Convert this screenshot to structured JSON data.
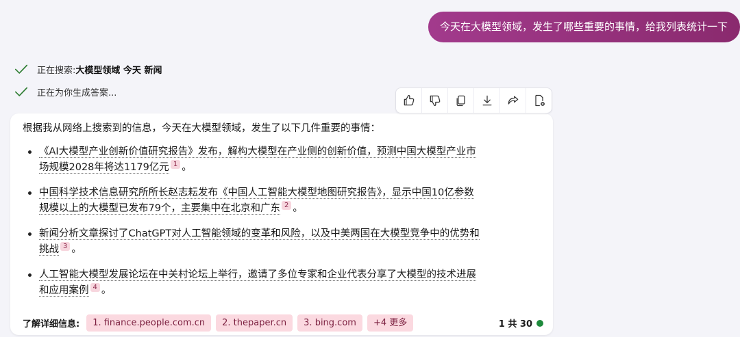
{
  "user_message": "今天在大模型领域，发生了哪些重要的事情，给我列表统计一下",
  "status": {
    "search_prefix": "正在搜索: ",
    "search_query": "大模型领域 今天 新闻",
    "generating": "正在为你生成答案..."
  },
  "toolbar": {
    "icons": [
      "thumbs-up-icon",
      "thumbs-down-icon",
      "copy-icon",
      "download-icon",
      "share-icon",
      "export-icon"
    ]
  },
  "answer": {
    "intro": "根据我从网络上搜索到的信息，今天在大模型领域，发生了以下几件重要的事情：",
    "items": [
      {
        "line1": "《AI大模型产业创新价值研究报告》发布，解构大模型在产业侧的创新价值，预测中国大模型产业市",
        "line2": "场规模2028年将达1179亿元",
        "cite": "1",
        "end": "。"
      },
      {
        "line1": "中国科学技术信息研究所所长赵志耘发布《中国人工智能大模型地图研究报告》，显示中国10亿参数",
        "line2": "规模以上的大模型已发布79个，主要集中在北京和广东",
        "cite": "2",
        "end": "。"
      },
      {
        "line1": "新闻分析文章探讨了ChatGPT对人工智能领域的变革和风险，以及中美两国在大模型竞争中的优势和",
        "line2": "挑战",
        "cite": "3",
        "end": "。"
      },
      {
        "line1": "人工智能大模型发展论坛在中关村论坛上举行，邀请了多位专家和企业代表分享了大模型的技术进展",
        "line2": "和应用案例",
        "cite": "4",
        "end": "。"
      }
    ]
  },
  "sources": {
    "label": "了解详细信息:",
    "links": [
      "1. finance.people.com.cn",
      "2. thepaper.cn",
      "3. bing.com"
    ],
    "more": "+4 更多",
    "counter": "1 共 30"
  },
  "colors": {
    "user_bubble": "#9b348a",
    "citation_chip": "#fbd9e0",
    "status_check": "#2e7d32",
    "counter_dot": "#1e8a3c"
  }
}
